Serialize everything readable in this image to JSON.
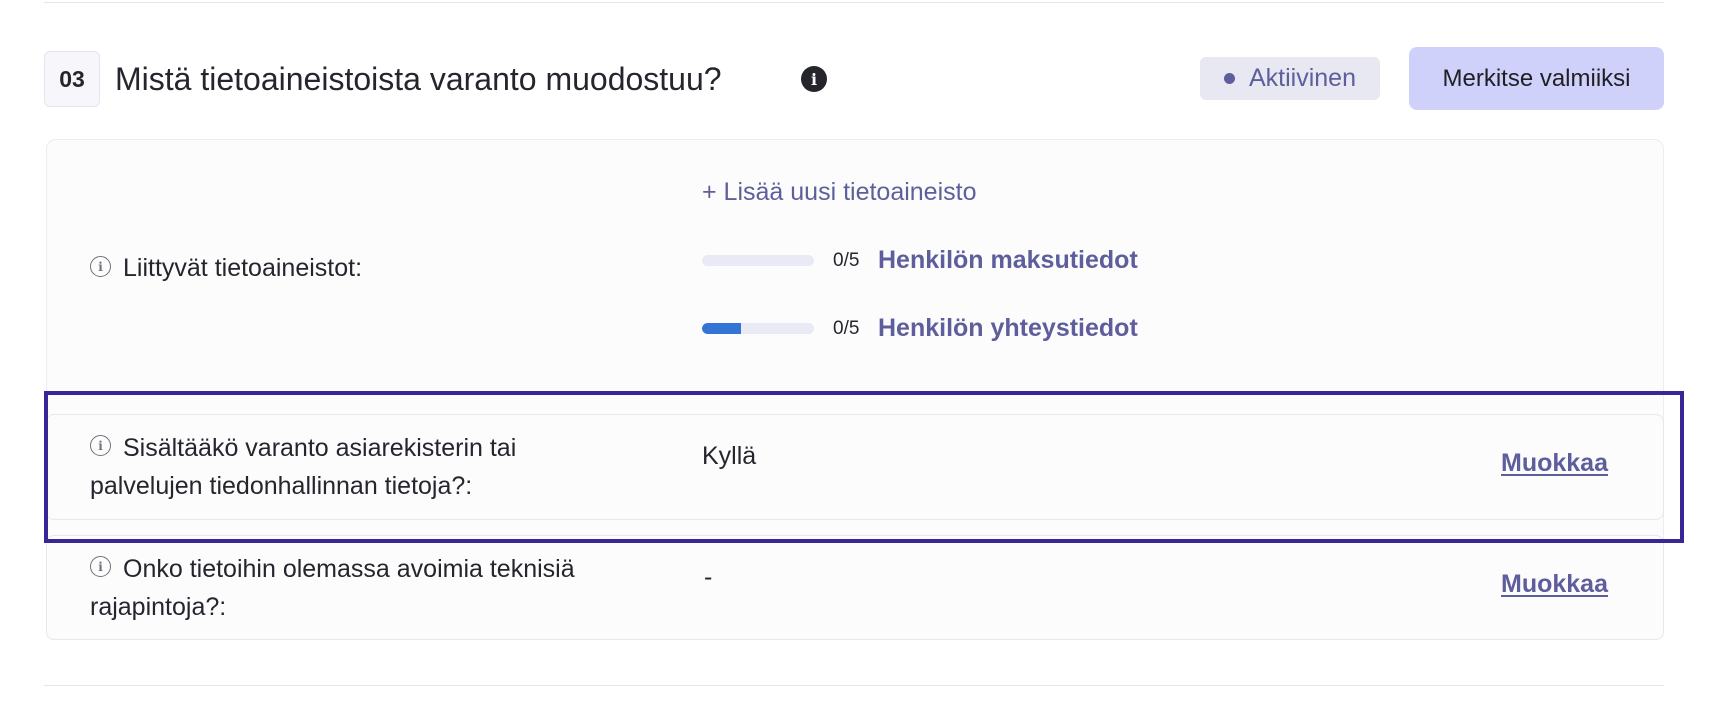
{
  "section": {
    "number": "03",
    "title": "Mistä tietoaineistoista varanto muodostuu?",
    "status": "Aktiivinen",
    "complete_button": "Merkitse valmiiksi"
  },
  "datasets": {
    "label": "Liittyvät tietoaineistot:",
    "add_link": "+ Lisää uusi tietoaineisto",
    "items": [
      {
        "count": "0/5",
        "name": "Henkilön maksutiedot",
        "progress": 0
      },
      {
        "count": "0/5",
        "name": "Henkilön yhteystiedot",
        "progress": 0.35
      }
    ]
  },
  "fields": [
    {
      "label": "Sisältääkö varanto asiarekisterin tai palvelujen tiedonhallinnan tietoja?:",
      "value": "Kyllä",
      "edit": "Muokkaa"
    },
    {
      "label": "Onko tietoihin olemassa avoimia teknisiä rajapintoja?:",
      "value": "-",
      "edit": "Muokkaa"
    }
  ],
  "colors": {
    "accent": "#5e5e9c",
    "button_bg": "#d0d1fa",
    "progress_fill": "#3474d4",
    "highlight": "#3a2797"
  }
}
